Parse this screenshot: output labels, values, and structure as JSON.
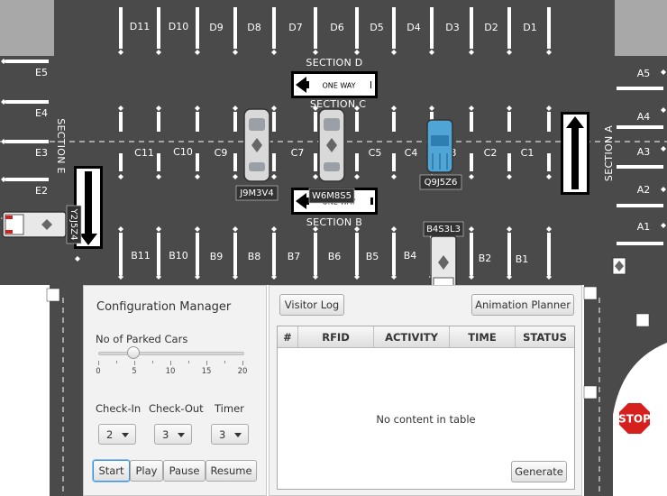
{
  "colors": {
    "asphalt": "#4a4a4a",
    "lines": "#ffffff",
    "panel": "#f2f2f2",
    "stop_sign": "#d6201e",
    "focus": "#3a8fd8"
  },
  "lot": {
    "sections": {
      "a": "SECTION A",
      "b": "SECTION B",
      "c": "SECTION C",
      "d": "SECTION D",
      "e": "SECTION E"
    },
    "bays": {
      "d": [
        "D11",
        "D10",
        "D9",
        "D8",
        "D7",
        "D6",
        "D5",
        "D4",
        "D3",
        "D2",
        "D1"
      ],
      "c": [
        "C11",
        "C10",
        "C9",
        "C7",
        "C5",
        "C4",
        "3",
        "C2",
        "C1"
      ],
      "b": [
        "B11",
        "B10",
        "B9",
        "B8",
        "B7",
        "B6",
        "B5",
        "B4",
        "B2",
        "B1"
      ],
      "a": [
        "A5",
        "A4",
        "A3",
        "A2",
        "A1"
      ],
      "e": [
        "E5",
        "E4",
        "E3",
        "E2"
      ]
    },
    "one_way_label": "ONE WAY",
    "stop_label": "STOP",
    "vehicles": [
      {
        "plate": "J9M3V4",
        "bay": "C8"
      },
      {
        "plate": "W6M8S5",
        "bay": "C6"
      },
      {
        "plate": "Q9J5Z6",
        "bay": "C3"
      },
      {
        "plate": "B4S3L3",
        "bay": "B3"
      },
      {
        "plate": "Y2J5Z4",
        "bay": "E1"
      }
    ]
  },
  "config": {
    "title": "Configuration Manager",
    "parked_cars_label": "No of Parked Cars",
    "parked_cars_value": 5,
    "slider_min": 0,
    "slider_max": 20,
    "tick_labels": [
      "0",
      "5",
      "10",
      "15",
      "20"
    ],
    "check_in_label": "Check-In",
    "check_in_value": "2",
    "check_out_label": "Check-Out",
    "check_out_value": "3",
    "timer_label": "Timer",
    "timer_value": "3",
    "buttons": {
      "start": "Start",
      "play": "Play",
      "pause": "Pause",
      "resume": "Resume"
    }
  },
  "log": {
    "visitor_log_button": "Visitor Log",
    "animation_planner_button": "Animation Planner",
    "columns": [
      "#",
      "RFID",
      "ACTIVITY",
      "TIME",
      "STATUS"
    ],
    "empty_text": "No content in table",
    "generate_button": "Generate"
  }
}
